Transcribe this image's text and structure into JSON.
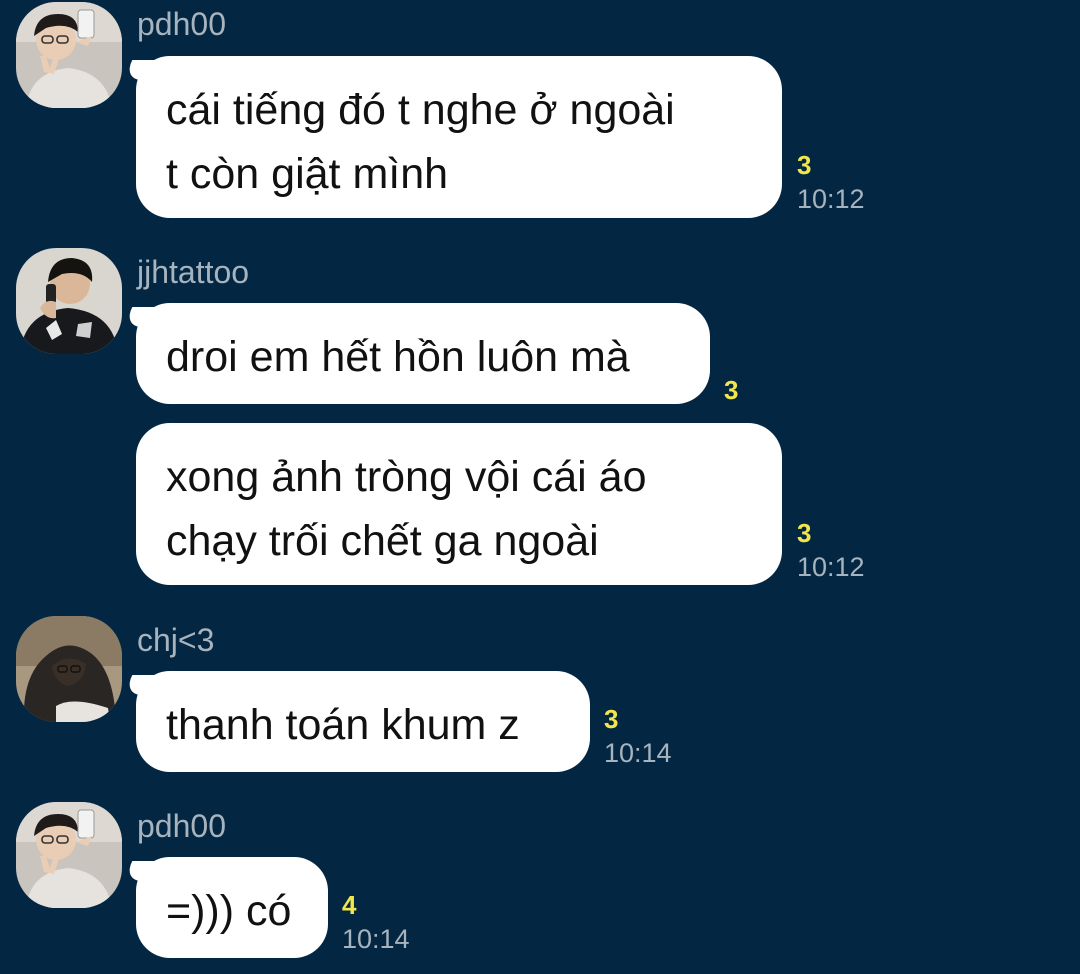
{
  "messages": [
    {
      "sender": "pdh00",
      "avatar_icon": "user-avatar-selfie-icon",
      "bubbles": [
        {
          "lines": [
            "cái tiếng đó t nghe ở ngoài",
            "t còn giật mình"
          ],
          "unread": "3",
          "time": "10:12"
        }
      ]
    },
    {
      "sender": "jjhtattoo",
      "avatar_icon": "user-avatar-phone-icon",
      "bubbles": [
        {
          "lines": [
            "droi em hết hồn luôn mà"
          ],
          "unread": "3",
          "time": ""
        },
        {
          "lines": [
            "xong ảnh tròng vội cái áo",
            "chạy trối chết ga ngoài"
          ],
          "unread": "3",
          "time": "10:12"
        }
      ]
    },
    {
      "sender": "chj<3",
      "avatar_icon": "user-avatar-hoodie-icon",
      "bubbles": [
        {
          "lines": [
            "thanh toán khum z"
          ],
          "unread": "3",
          "time": "10:14"
        }
      ]
    },
    {
      "sender": "pdh00",
      "avatar_icon": "user-avatar-selfie-icon",
      "bubbles": [
        {
          "lines": [
            "=))) có"
          ],
          "unread": "4",
          "time": "10:14"
        }
      ]
    }
  ],
  "colors": {
    "background": "#032742",
    "bubble": "#ffffff",
    "unread": "#f2e64b",
    "meta_text": "#a7b3bd"
  }
}
